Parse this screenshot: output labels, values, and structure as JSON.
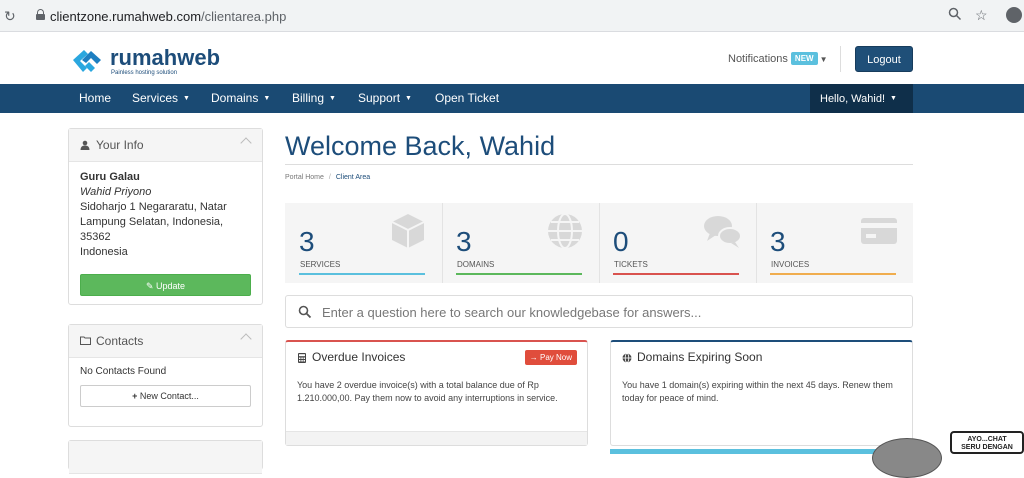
{
  "browser": {
    "url_domain": "clientzone.rumahweb.com",
    "url_path": "/clientarea.php"
  },
  "header": {
    "logo_text": "rumahweb",
    "logo_tagline": "Painless hosting solution",
    "notifications_label": "Notifications",
    "notifications_badge": "NEW",
    "logout_label": "Logout"
  },
  "nav": {
    "items": [
      {
        "label": "Home"
      },
      {
        "label": "Services"
      },
      {
        "label": "Domains"
      },
      {
        "label": "Billing"
      },
      {
        "label": "Support"
      },
      {
        "label": "Open Ticket"
      }
    ],
    "user_greeting": "Hello, Wahid!"
  },
  "sidebar": {
    "your_info": {
      "title": "Your Info",
      "company": "Guru Galau",
      "name": "Wahid Priyono",
      "address_line1": "Sidoharjo 1 Negararatu, Natar",
      "address_line2": "Lampung Selatan, Indonesia,",
      "postcode": "35362",
      "country": "Indonesia",
      "update_label": "Update"
    },
    "contacts": {
      "title": "Contacts",
      "empty_text": "No Contacts Found",
      "new_contact_label": "New Contact..."
    }
  },
  "main": {
    "title": "Welcome Back, Wahid",
    "breadcrumb": [
      "Portal Home",
      "Client Area"
    ],
    "stats": [
      {
        "value": "3",
        "label": "SERVICES",
        "color": "#5bc0de"
      },
      {
        "value": "3",
        "label": "DOMAINS",
        "color": "#5cb85c"
      },
      {
        "value": "0",
        "label": "TICKETS",
        "color": "#d9534f"
      },
      {
        "value": "3",
        "label": "INVOICES",
        "color": "#f0ad4e"
      }
    ],
    "search_placeholder": "Enter a question here to search our knowledgebase for answers...",
    "overdue": {
      "title": "Overdue Invoices",
      "button": "Pay Now",
      "text": "You have 2 overdue invoice(s) with a total balance due of Rp 1.210.000,00. Pay them now to avoid any interruptions in service.",
      "accent": "#d9534f"
    },
    "domains_expiring": {
      "title": "Domains Expiring Soon",
      "text": "You have 1 domain(s) expiring within the next 45 days. Renew them today for peace of mind.",
      "accent": "#1d4d7a"
    }
  },
  "chat": {
    "line1": "AYO...CHAT",
    "line2": "SERU DENGAN"
  }
}
